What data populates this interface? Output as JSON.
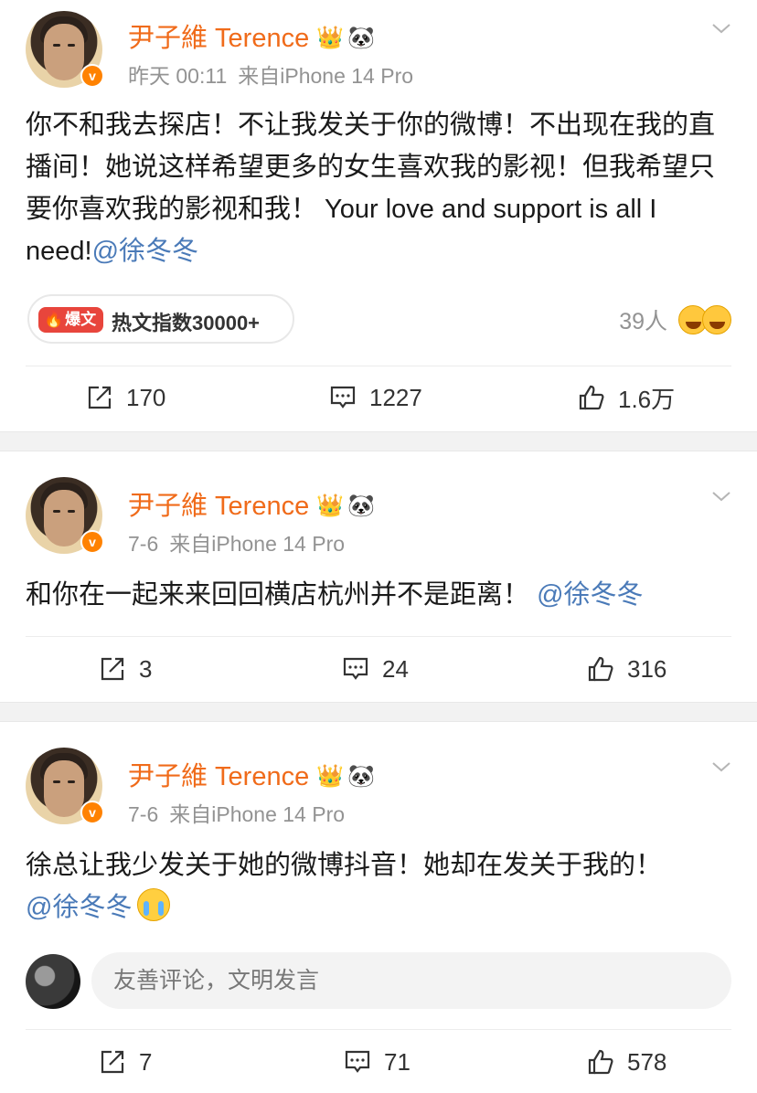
{
  "posts": [
    {
      "author": "尹子維 Terence",
      "time": "昨天 00:11",
      "source": "来自iPhone 14 Pro",
      "text": "你不和我去探店！不让我发关于你的微博！不出现在我的直播间！她说这样希望更多的女生喜欢我的影视！但我希望只要你喜欢我的影视和我！ Your love and support is all I need!",
      "mention": "@徐冬冬",
      "hot_tag": "爆文",
      "hot_label": "热文指数30000+",
      "likers": "39人",
      "reposts": "170",
      "comments": "1227",
      "likes": "1.6万"
    },
    {
      "author": "尹子維 Terence",
      "time": "7-6",
      "source": "来自iPhone 14 Pro",
      "text": "和你在一起来来回回横店杭州并不是距离！",
      "mention": "@徐冬冬",
      "reposts": "3",
      "comments": "24",
      "likes": "316"
    },
    {
      "author": "尹子維 Terence",
      "time": "7-6",
      "source": "来自iPhone 14 Pro",
      "text": "徐总让我少发关于她的微博抖音！她却在发关于我的！",
      "mention": "@徐冬冬",
      "comment_placeholder": "友善评论，文明发言",
      "reposts": "7",
      "comments": "71",
      "likes": "578"
    }
  ],
  "icons": {
    "verified": "verified-v-badge-icon",
    "crown": "crown-icon",
    "panda": "panda-icon",
    "menu": "chevron-down-icon",
    "repost": "repost-icon",
    "comment": "comment-icon",
    "like": "thumbs-up-icon",
    "crying_emoji": "crying-emoji-icon"
  },
  "colors": {
    "author": "#f06b1a",
    "mention": "#4a7ab8",
    "hot_tag": "#e8453c",
    "verified": "#ff8200"
  }
}
